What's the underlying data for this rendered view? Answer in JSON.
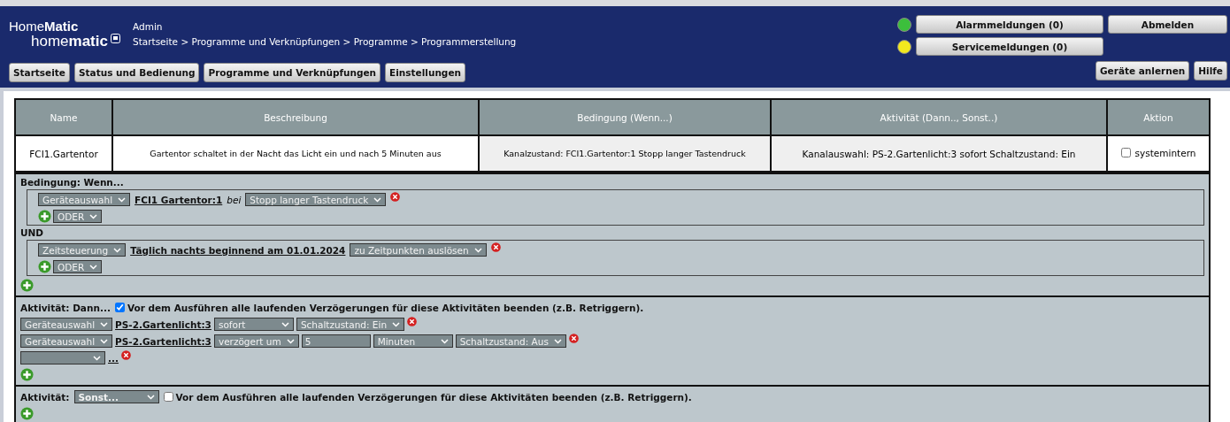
{
  "header": {
    "logo_top": "Home**Matic**",
    "logo_bottom": "home**matic**",
    "user": "Admin",
    "breadcrumb": "Startseite > Programme und Verknüpfungen > Programme > Programmerstellung",
    "nav": [
      "Startseite",
      "Status und Bedienung",
      "Programme und Verknüpfungen",
      "Einstellungen"
    ],
    "messages": [
      {
        "label": "Alarmmeldungen (0)",
        "color": "#3cbf3c"
      },
      {
        "label": "Servicemeldungen (0)",
        "color": "#f2e81e"
      }
    ],
    "logout": "Abmelden",
    "tools": [
      "Geräte anlernen",
      "Hilfe"
    ]
  },
  "table": {
    "columns": [
      "Name",
      "Beschreibung",
      "Bedingung (Wenn...)",
      "Aktivität (Dann.., Sonst..)",
      "Aktion"
    ],
    "row": {
      "name": "FCI1.Gartentor",
      "description": "Gartentor schaltet in der Nacht das Licht ein und nach 5 Minuten aus",
      "condition": "Kanalzustand: FCI1.Gartentor:1 Stopp langer Tastendruck",
      "activity": "Kanalauswahl: PS-2.Gartenlicht:3 sofort Schaltzustand: Ein",
      "system": {
        "label": "systemintern",
        "checked": false
      }
    }
  },
  "condition": {
    "title": "Bedingung: Wenn...",
    "joiner": "UND",
    "groups": [
      {
        "items": [
          {
            "kind": "select",
            "value": "Geräteauswahl"
          },
          {
            "kind": "link",
            "text": "FCI1 Gartentor:1"
          },
          {
            "kind": "text",
            "text": "bei"
          },
          {
            "kind": "select",
            "value": "Stopp langer Tastendruck"
          }
        ],
        "or": "ODER"
      },
      {
        "items": [
          {
            "kind": "select",
            "value": "Zeitsteuerung"
          },
          {
            "kind": "link",
            "text": "Täglich nachts beginnend am 01.01.2024"
          },
          {
            "kind": "select",
            "value": "zu Zeitpunkten auslösen"
          }
        ],
        "or": "ODER"
      }
    ]
  },
  "then": {
    "title": "Aktivität: Dann...",
    "stop": {
      "checked": true,
      "label": "Vor dem Ausführen alle laufenden Verzögerungen für diese Aktivitäten beenden (z.B. Retriggern)."
    },
    "rows": [
      [
        {
          "kind": "select",
          "value": "Geräteauswahl"
        },
        {
          "kind": "link",
          "text": "PS-2.Gartenlicht:3"
        },
        {
          "kind": "select",
          "value": "sofort"
        },
        {
          "kind": "select",
          "value": "Schaltzustand: Ein"
        }
      ],
      [
        {
          "kind": "select",
          "value": "Geräteauswahl"
        },
        {
          "kind": "link",
          "text": "PS-2.Gartenlicht:3"
        },
        {
          "kind": "select",
          "value": "verzögert um"
        },
        {
          "kind": "input",
          "value": "5"
        },
        {
          "kind": "select",
          "value": "Minuten"
        },
        {
          "kind": "select",
          "value": "Schaltzustand: Aus"
        }
      ],
      [
        {
          "kind": "select"
        },
        {
          "kind": "link",
          "text": "..."
        }
      ]
    ]
  },
  "else": {
    "title": "Aktivität:",
    "select": "Sonst...",
    "stop": {
      "checked": false,
      "label": "Vor dem Ausführen alle laufenden Verzögerungen für diese Aktivitäten beenden (z.B. Retriggern)."
    }
  }
}
